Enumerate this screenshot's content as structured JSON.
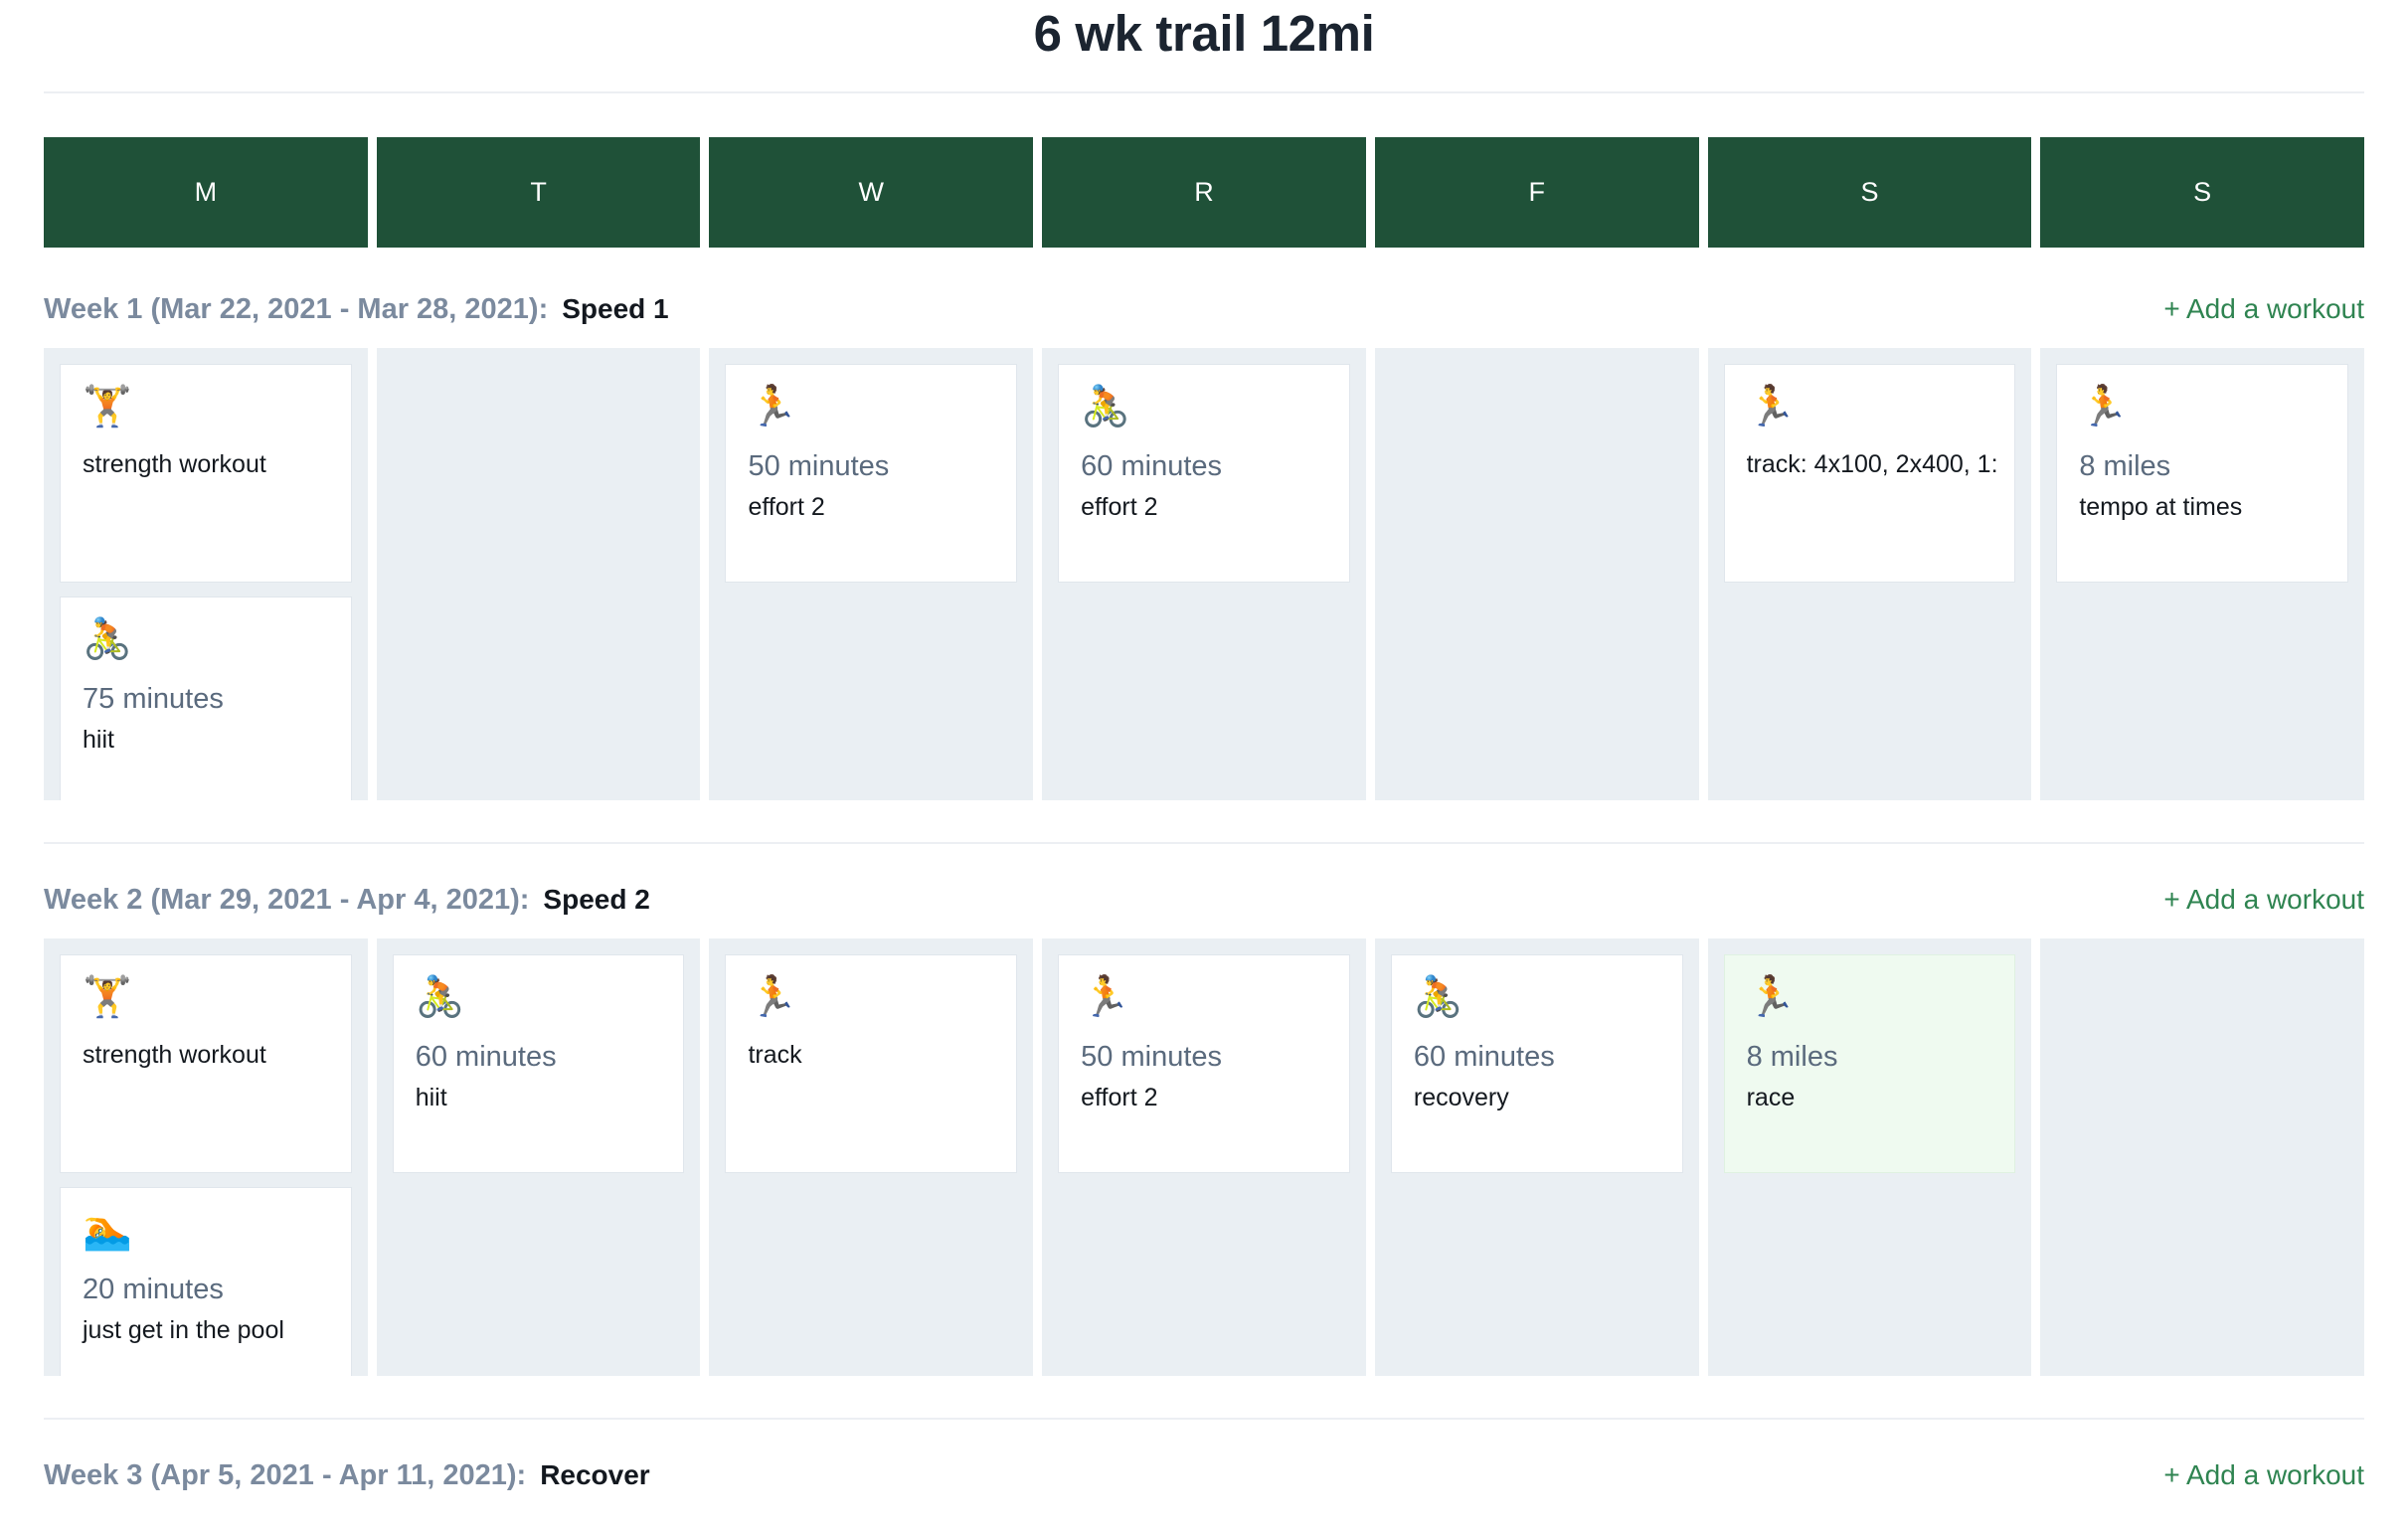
{
  "header": {
    "title": "6 wk trail 12mi"
  },
  "day_headers": [
    {
      "label": "M",
      "name": "monday"
    },
    {
      "label": "T",
      "name": "tuesday"
    },
    {
      "label": "W",
      "name": "wednesday"
    },
    {
      "label": "R",
      "name": "thursday"
    },
    {
      "label": "F",
      "name": "friday"
    },
    {
      "label": "S",
      "name": "saturday"
    },
    {
      "label": "S",
      "name": "sunday"
    }
  ],
  "colors": {
    "header_green": "#1f5138",
    "day_column_bg": "#eaeff3",
    "card_bg": "#ffffff",
    "race_card_bg": "#effaf0",
    "link_green": "#2f8451",
    "week_label": "#7b8a9e",
    "duration_text": "#5a6a7d",
    "title_text": "#1b2430"
  },
  "add_workout_label": "+ Add a workout",
  "weeks": [
    {
      "label": "Week 1 (Mar 22, 2021 - Mar 28, 2021):",
      "name": "Speed 1",
      "days": [
        {
          "day": "M",
          "workouts": [
            {
              "icon": "weightlifter-icon",
              "emoji": "🏋️",
              "duration": "",
              "desc": "strength workout",
              "highlight": false
            },
            {
              "icon": "cyclist-icon",
              "emoji": "🚴",
              "duration": "75 minutes",
              "desc": "hiit",
              "highlight": false
            }
          ]
        },
        {
          "day": "T",
          "workouts": []
        },
        {
          "day": "W",
          "workouts": [
            {
              "icon": "runner-icon",
              "emoji": "🏃",
              "duration": "50 minutes",
              "desc": "effort 2",
              "highlight": false
            }
          ]
        },
        {
          "day": "R",
          "workouts": [
            {
              "icon": "cyclist-icon",
              "emoji": "🚴",
              "duration": "60 minutes",
              "desc": "effort 2",
              "highlight": false
            }
          ]
        },
        {
          "day": "F",
          "workouts": []
        },
        {
          "day": "S",
          "workouts": [
            {
              "icon": "runner-icon",
              "emoji": "🏃",
              "duration": "",
              "desc": "track: 4x100, 2x400, 1:",
              "highlight": false
            }
          ]
        },
        {
          "day": "S",
          "workouts": [
            {
              "icon": "runner-icon",
              "emoji": "🏃",
              "duration": "8 miles",
              "desc": "tempo at times",
              "highlight": false
            }
          ]
        }
      ]
    },
    {
      "label": "Week 2 (Mar 29, 2021 - Apr 4, 2021):",
      "name": "Speed 2",
      "days": [
        {
          "day": "M",
          "workouts": [
            {
              "icon": "weightlifter-icon",
              "emoji": "🏋️",
              "duration": "",
              "desc": "strength workout",
              "highlight": false
            },
            {
              "icon": "swimmer-icon",
              "emoji": "🏊",
              "duration": "20 minutes",
              "desc": "just get in the pool",
              "highlight": false
            }
          ]
        },
        {
          "day": "T",
          "workouts": [
            {
              "icon": "cyclist-icon",
              "emoji": "🚴",
              "duration": "60 minutes",
              "desc": "hiit",
              "highlight": false
            }
          ]
        },
        {
          "day": "W",
          "workouts": [
            {
              "icon": "runner-icon",
              "emoji": "🏃",
              "duration": "",
              "desc": "track",
              "highlight": false
            }
          ]
        },
        {
          "day": "R",
          "workouts": [
            {
              "icon": "runner-icon",
              "emoji": "🏃",
              "duration": "50 minutes",
              "desc": "effort 2",
              "highlight": false
            }
          ]
        },
        {
          "day": "F",
          "workouts": [
            {
              "icon": "cyclist-icon",
              "emoji": "🚴",
              "duration": "60 minutes",
              "desc": "recovery",
              "highlight": false
            }
          ]
        },
        {
          "day": "S",
          "workouts": [
            {
              "icon": "runner-icon",
              "emoji": "🏃",
              "duration": "8 miles",
              "desc": "race",
              "highlight": true
            }
          ]
        },
        {
          "day": "S",
          "workouts": []
        }
      ]
    },
    {
      "label": "Week 3 (Apr 5, 2021 - Apr 11, 2021):",
      "name": "Recover",
      "days": []
    }
  ]
}
